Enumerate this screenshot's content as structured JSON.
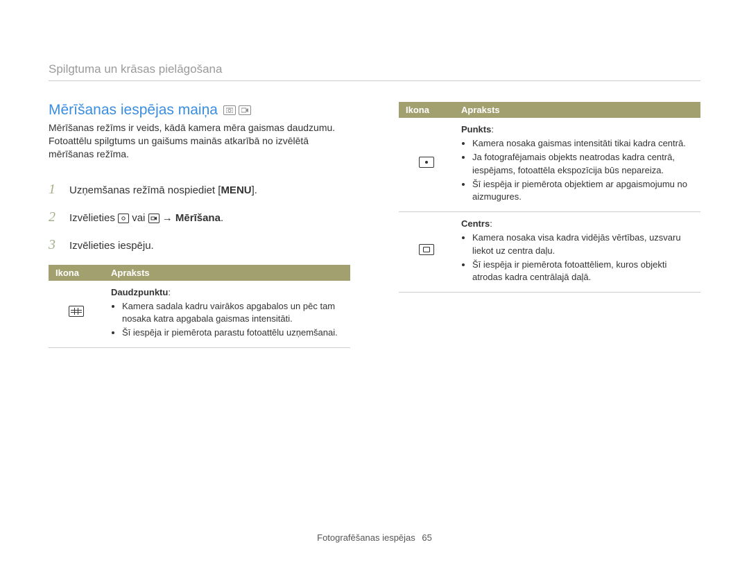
{
  "breadcrumb": "Spilgtuma un krāsas pielāgošana",
  "heading": "Mērīšanas iespējas maiņa",
  "intro": "Mērīšanas režīms ir veids, kādā kamera mēra gaismas daudzumu. Fotoattēlu spilgtums un gaišums mainās atkarībā no izvēlētā mērīšanas režīma.",
  "steps": {
    "s1a": "Uzņemšanas režīmā nospiediet [",
    "s1b": "MENU",
    "s1c": "].",
    "s2a": "Izvēlieties ",
    "s2b": " vai ",
    "s2c": " → ",
    "s2d": "Mērīšana",
    "s2e": ".",
    "s3": "Izvēlieties iespēju."
  },
  "table": {
    "h_icon": "Ikona",
    "h_desc": "Apraksts",
    "r1": {
      "title": "Daudzpunktu",
      "b1": "Kamera sadala kadru vairākos apgabalos un pēc tam nosaka katra apgabala gaismas intensitāti.",
      "b2": "Šī iespēja ir piemērota parastu fotoattēlu uzņemšanai."
    },
    "r2": {
      "title": "Punkts",
      "b1": "Kamera nosaka gaismas intensitāti tikai kadra centrā.",
      "b2": "Ja fotografējamais objekts neatrodas kadra centrā, iespējams, fotoattēla ekspozīcija būs nepareiza.",
      "b3": "Šī iespēja ir piemērota objektiem ar apgaismojumu no aizmugures."
    },
    "r3": {
      "title": "Centrs",
      "b1": "Kamera nosaka visa kadra vidējās vērtības, uzsvaru liekot uz centra daļu.",
      "b2": "Šī iespēja ir piemērota fotoattēliem, kuros objekti atrodas kadra centrālajā daļā."
    }
  },
  "footer": {
    "section": "Fotografēšanas iespējas",
    "page": "65"
  }
}
